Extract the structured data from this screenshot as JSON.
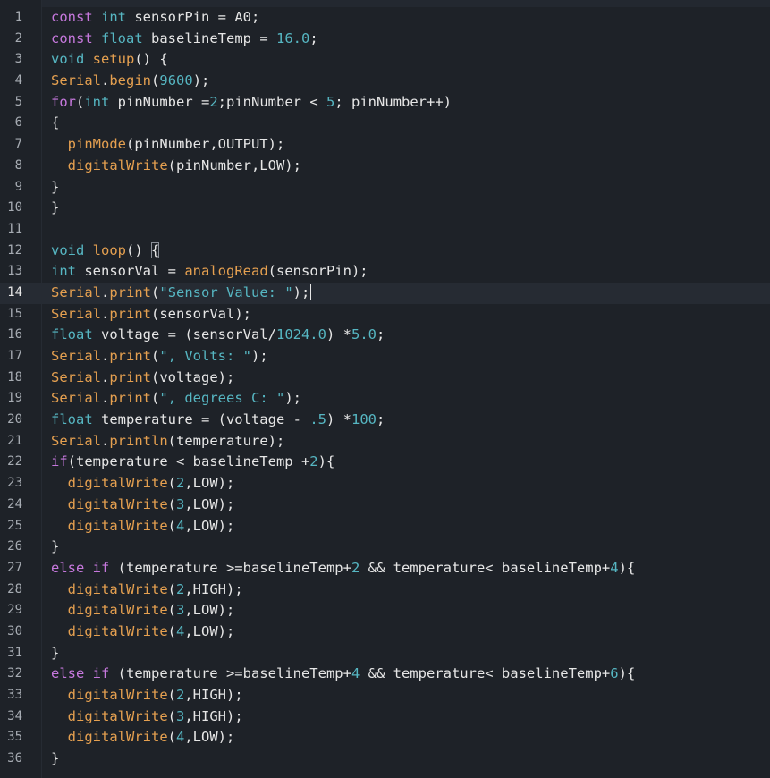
{
  "editor": {
    "caret_line": 14,
    "lines": [
      {
        "n": "1",
        "tokens": [
          {
            "t": "kw",
            "v": "const "
          },
          {
            "t": "type",
            "v": "int"
          },
          {
            "t": "plain",
            "v": " sensorPin = A0;"
          }
        ]
      },
      {
        "n": "2",
        "tokens": [
          {
            "t": "kw",
            "v": "const "
          },
          {
            "t": "type",
            "v": "float"
          },
          {
            "t": "plain",
            "v": " baselineTemp = "
          },
          {
            "t": "num",
            "v": "16.0"
          },
          {
            "t": "plain",
            "v": ";"
          }
        ]
      },
      {
        "n": "3",
        "tokens": [
          {
            "t": "type",
            "v": "void "
          },
          {
            "t": "fn",
            "v": "setup"
          },
          {
            "t": "plain",
            "v": "() {"
          }
        ]
      },
      {
        "n": "4",
        "tokens": [
          {
            "t": "fn",
            "v": "Serial"
          },
          {
            "t": "plain",
            "v": "."
          },
          {
            "t": "fn",
            "v": "begin"
          },
          {
            "t": "plain",
            "v": "("
          },
          {
            "t": "num",
            "v": "9600"
          },
          {
            "t": "plain",
            "v": ");"
          }
        ]
      },
      {
        "n": "5",
        "tokens": [
          {
            "t": "kw",
            "v": "for"
          },
          {
            "t": "plain",
            "v": "("
          },
          {
            "t": "type",
            "v": "int"
          },
          {
            "t": "plain",
            "v": " pinNumber ="
          },
          {
            "t": "num",
            "v": "2"
          },
          {
            "t": "plain",
            "v": ";pinNumber < "
          },
          {
            "t": "num",
            "v": "5"
          },
          {
            "t": "plain",
            "v": "; pinNumber++)"
          }
        ]
      },
      {
        "n": "6",
        "tokens": [
          {
            "t": "plain",
            "v": "{"
          }
        ]
      },
      {
        "n": "7",
        "tokens": [
          {
            "t": "plain",
            "v": "  "
          },
          {
            "t": "fn",
            "v": "pinMode"
          },
          {
            "t": "plain",
            "v": "(pinNumber,OUTPUT);"
          }
        ]
      },
      {
        "n": "8",
        "tokens": [
          {
            "t": "plain",
            "v": "  "
          },
          {
            "t": "fn",
            "v": "digitalWrite"
          },
          {
            "t": "plain",
            "v": "(pinNumber,LOW);"
          }
        ]
      },
      {
        "n": "9",
        "tokens": [
          {
            "t": "plain",
            "v": "}"
          }
        ]
      },
      {
        "n": "10",
        "tokens": [
          {
            "t": "plain",
            "v": "}"
          }
        ]
      },
      {
        "n": "11",
        "tokens": []
      },
      {
        "n": "12",
        "tokens": [
          {
            "t": "type",
            "v": "void "
          },
          {
            "t": "fn",
            "v": "loop"
          },
          {
            "t": "plain",
            "v": "() "
          },
          {
            "t": "brace",
            "v": "{"
          }
        ]
      },
      {
        "n": "13",
        "tokens": [
          {
            "t": "type",
            "v": "int"
          },
          {
            "t": "plain",
            "v": " sensorVal = "
          },
          {
            "t": "fn",
            "v": "analogRead"
          },
          {
            "t": "plain",
            "v": "(sensorPin);"
          }
        ]
      },
      {
        "n": "14",
        "tokens": [
          {
            "t": "fn",
            "v": "Serial"
          },
          {
            "t": "plain",
            "v": "."
          },
          {
            "t": "fn",
            "v": "print"
          },
          {
            "t": "plain",
            "v": "("
          },
          {
            "t": "str",
            "v": "\"Sensor Value: \""
          },
          {
            "t": "plain",
            "v": ");"
          }
        ]
      },
      {
        "n": "15",
        "tokens": [
          {
            "t": "fn",
            "v": "Serial"
          },
          {
            "t": "plain",
            "v": "."
          },
          {
            "t": "fn",
            "v": "print"
          },
          {
            "t": "plain",
            "v": "(sensorVal);"
          }
        ]
      },
      {
        "n": "16",
        "tokens": [
          {
            "t": "type",
            "v": "float"
          },
          {
            "t": "plain",
            "v": " voltage = (sensorVal/"
          },
          {
            "t": "num",
            "v": "1024.0"
          },
          {
            "t": "plain",
            "v": ") *"
          },
          {
            "t": "num",
            "v": "5.0"
          },
          {
            "t": "plain",
            "v": ";"
          }
        ]
      },
      {
        "n": "17",
        "tokens": [
          {
            "t": "fn",
            "v": "Serial"
          },
          {
            "t": "plain",
            "v": "."
          },
          {
            "t": "fn",
            "v": "print"
          },
          {
            "t": "plain",
            "v": "("
          },
          {
            "t": "str",
            "v": "\", Volts: \""
          },
          {
            "t": "plain",
            "v": ");"
          }
        ]
      },
      {
        "n": "18",
        "tokens": [
          {
            "t": "fn",
            "v": "Serial"
          },
          {
            "t": "plain",
            "v": "."
          },
          {
            "t": "fn",
            "v": "print"
          },
          {
            "t": "plain",
            "v": "(voltage);"
          }
        ]
      },
      {
        "n": "19",
        "tokens": [
          {
            "t": "fn",
            "v": "Serial"
          },
          {
            "t": "plain",
            "v": "."
          },
          {
            "t": "fn",
            "v": "print"
          },
          {
            "t": "plain",
            "v": "("
          },
          {
            "t": "str",
            "v": "\", degrees C: \""
          },
          {
            "t": "plain",
            "v": ");"
          }
        ]
      },
      {
        "n": "20",
        "tokens": [
          {
            "t": "type",
            "v": "float"
          },
          {
            "t": "plain",
            "v": " temperature = (voltage - "
          },
          {
            "t": "num",
            "v": ".5"
          },
          {
            "t": "plain",
            "v": ") *"
          },
          {
            "t": "num",
            "v": "100"
          },
          {
            "t": "plain",
            "v": ";"
          }
        ]
      },
      {
        "n": "21",
        "tokens": [
          {
            "t": "fn",
            "v": "Serial"
          },
          {
            "t": "plain",
            "v": "."
          },
          {
            "t": "fn",
            "v": "println"
          },
          {
            "t": "plain",
            "v": "(temperature);"
          }
        ]
      },
      {
        "n": "22",
        "tokens": [
          {
            "t": "kw",
            "v": "if"
          },
          {
            "t": "plain",
            "v": "(temperature < baselineTemp +"
          },
          {
            "t": "num",
            "v": "2"
          },
          {
            "t": "plain",
            "v": "){"
          }
        ]
      },
      {
        "n": "23",
        "tokens": [
          {
            "t": "plain",
            "v": "  "
          },
          {
            "t": "fn",
            "v": "digitalWrite"
          },
          {
            "t": "plain",
            "v": "("
          },
          {
            "t": "num",
            "v": "2"
          },
          {
            "t": "plain",
            "v": ",LOW);"
          }
        ]
      },
      {
        "n": "24",
        "tokens": [
          {
            "t": "plain",
            "v": "  "
          },
          {
            "t": "fn",
            "v": "digitalWrite"
          },
          {
            "t": "plain",
            "v": "("
          },
          {
            "t": "num",
            "v": "3"
          },
          {
            "t": "plain",
            "v": ",LOW);"
          }
        ]
      },
      {
        "n": "25",
        "tokens": [
          {
            "t": "plain",
            "v": "  "
          },
          {
            "t": "fn",
            "v": "digitalWrite"
          },
          {
            "t": "plain",
            "v": "("
          },
          {
            "t": "num",
            "v": "4"
          },
          {
            "t": "plain",
            "v": ",LOW);"
          }
        ]
      },
      {
        "n": "26",
        "tokens": [
          {
            "t": "plain",
            "v": "}"
          }
        ]
      },
      {
        "n": "27",
        "tokens": [
          {
            "t": "kw",
            "v": "else if"
          },
          {
            "t": "plain",
            "v": " (temperature >=baselineTemp+"
          },
          {
            "t": "num",
            "v": "2"
          },
          {
            "t": "plain",
            "v": " && temperature< baselineTemp+"
          },
          {
            "t": "num",
            "v": "4"
          },
          {
            "t": "plain",
            "v": "){"
          }
        ]
      },
      {
        "n": "28",
        "tokens": [
          {
            "t": "plain",
            "v": "  "
          },
          {
            "t": "fn",
            "v": "digitalWrite"
          },
          {
            "t": "plain",
            "v": "("
          },
          {
            "t": "num",
            "v": "2"
          },
          {
            "t": "plain",
            "v": ",HIGH);"
          }
        ]
      },
      {
        "n": "29",
        "tokens": [
          {
            "t": "plain",
            "v": "  "
          },
          {
            "t": "fn",
            "v": "digitalWrite"
          },
          {
            "t": "plain",
            "v": "("
          },
          {
            "t": "num",
            "v": "3"
          },
          {
            "t": "plain",
            "v": ",LOW);"
          }
        ]
      },
      {
        "n": "30",
        "tokens": [
          {
            "t": "plain",
            "v": "  "
          },
          {
            "t": "fn",
            "v": "digitalWrite"
          },
          {
            "t": "plain",
            "v": "("
          },
          {
            "t": "num",
            "v": "4"
          },
          {
            "t": "plain",
            "v": ",LOW);"
          }
        ]
      },
      {
        "n": "31",
        "tokens": [
          {
            "t": "plain",
            "v": "}"
          }
        ]
      },
      {
        "n": "32",
        "tokens": [
          {
            "t": "kw",
            "v": "else if"
          },
          {
            "t": "plain",
            "v": " (temperature >=baselineTemp+"
          },
          {
            "t": "num",
            "v": "4"
          },
          {
            "t": "plain",
            "v": " && temperature< baselineTemp+"
          },
          {
            "t": "num",
            "v": "6"
          },
          {
            "t": "plain",
            "v": "){"
          }
        ]
      },
      {
        "n": "33",
        "tokens": [
          {
            "t": "plain",
            "v": "  "
          },
          {
            "t": "fn",
            "v": "digitalWrite"
          },
          {
            "t": "plain",
            "v": "("
          },
          {
            "t": "num",
            "v": "2"
          },
          {
            "t": "plain",
            "v": ",HIGH);"
          }
        ]
      },
      {
        "n": "34",
        "tokens": [
          {
            "t": "plain",
            "v": "  "
          },
          {
            "t": "fn",
            "v": "digitalWrite"
          },
          {
            "t": "plain",
            "v": "("
          },
          {
            "t": "num",
            "v": "3"
          },
          {
            "t": "plain",
            "v": ",HIGH);"
          }
        ]
      },
      {
        "n": "35",
        "tokens": [
          {
            "t": "plain",
            "v": "  "
          },
          {
            "t": "fn",
            "v": "digitalWrite"
          },
          {
            "t": "plain",
            "v": "("
          },
          {
            "t": "num",
            "v": "4"
          },
          {
            "t": "plain",
            "v": ",LOW);"
          }
        ]
      },
      {
        "n": "36",
        "tokens": [
          {
            "t": "plain",
            "v": "}"
          }
        ]
      }
    ]
  }
}
